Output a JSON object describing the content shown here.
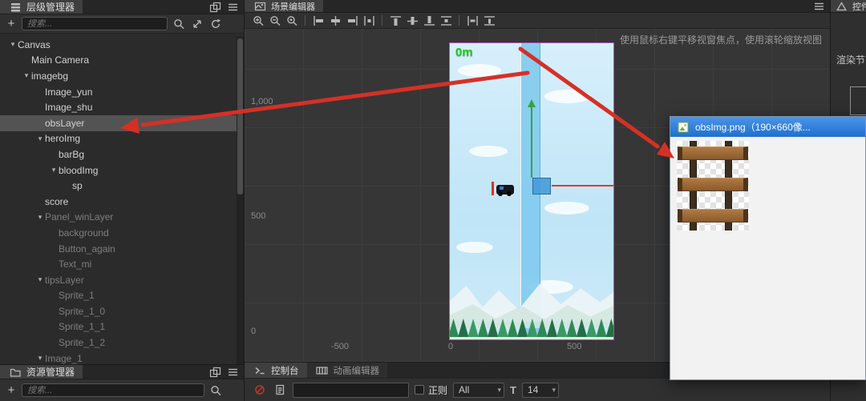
{
  "icons": {
    "caret": "▾",
    "tree_expanded": "▾"
  },
  "hierarchy": {
    "tab": "层级管理器",
    "add_button": "+",
    "search_placeholder": "搜索...",
    "tree": [
      {
        "label": "Canvas",
        "level": 0,
        "arrow": true
      },
      {
        "label": "Main Camera",
        "level": 1
      },
      {
        "label": "imagebg",
        "level": 1,
        "arrow": true
      },
      {
        "label": "Image_yun",
        "level": 2
      },
      {
        "label": "Image_shu",
        "level": 2
      },
      {
        "label": "obsLayer",
        "level": 2,
        "selected": true
      },
      {
        "label": "heroImg",
        "level": 2,
        "arrow": true
      },
      {
        "label": "barBg",
        "level": 3
      },
      {
        "label": "bloodImg",
        "level": 3,
        "arrow": true
      },
      {
        "label": "sp",
        "level": 4
      },
      {
        "label": "score",
        "level": 2
      },
      {
        "label": "Panel_winLayer",
        "level": 2,
        "arrow": true,
        "dim": true
      },
      {
        "label": "background",
        "level": 3,
        "dim": true
      },
      {
        "label": "Button_again",
        "level": 3,
        "dim": true
      },
      {
        "label": "Text_mi",
        "level": 3,
        "dim": true
      },
      {
        "label": "tipsLayer",
        "level": 2,
        "arrow": true,
        "dim": true
      },
      {
        "label": "Sprite_1",
        "level": 3,
        "dim": true
      },
      {
        "label": "Sprite_1_0",
        "level": 3,
        "dim": true
      },
      {
        "label": "Sprite_1_1",
        "level": 3,
        "dim": true
      },
      {
        "label": "Sprite_1_2",
        "level": 3,
        "dim": true
      },
      {
        "label": "Image_1",
        "level": 2,
        "arrow": true,
        "dim": true
      }
    ]
  },
  "assets": {
    "tab": "资源管理器",
    "add_button": "+",
    "search_placeholder": "搜索..."
  },
  "scene": {
    "tab": "场景编辑器",
    "hint": "使用鼠标右键平移视窗焦点，使用滚轮缩放视图",
    "distance_label": "0m",
    "ruler_y": [
      "1,000",
      "500",
      "0"
    ],
    "ruler_x": [
      "-500",
      "0",
      "500"
    ],
    "toolbar": [
      "zoom-in",
      "zoom-out",
      "zoom-reset",
      "sep",
      "align-left",
      "align-center-h",
      "align-right",
      "distribute-h",
      "sep",
      "align-top",
      "align-middle",
      "align-bottom",
      "distribute-v",
      "sep",
      "stretch-h",
      "stretch-v"
    ]
  },
  "console": {
    "tab": "控制台",
    "animation_tab": "动画编辑器",
    "regex_label": "正则",
    "filter_value": "All",
    "font_icon": "T",
    "font_size_value": "14"
  },
  "inspector": {
    "tab": "控件",
    "section_label": "渲染节"
  },
  "popup": {
    "title": "obsImg.png（190×660像..."
  }
}
